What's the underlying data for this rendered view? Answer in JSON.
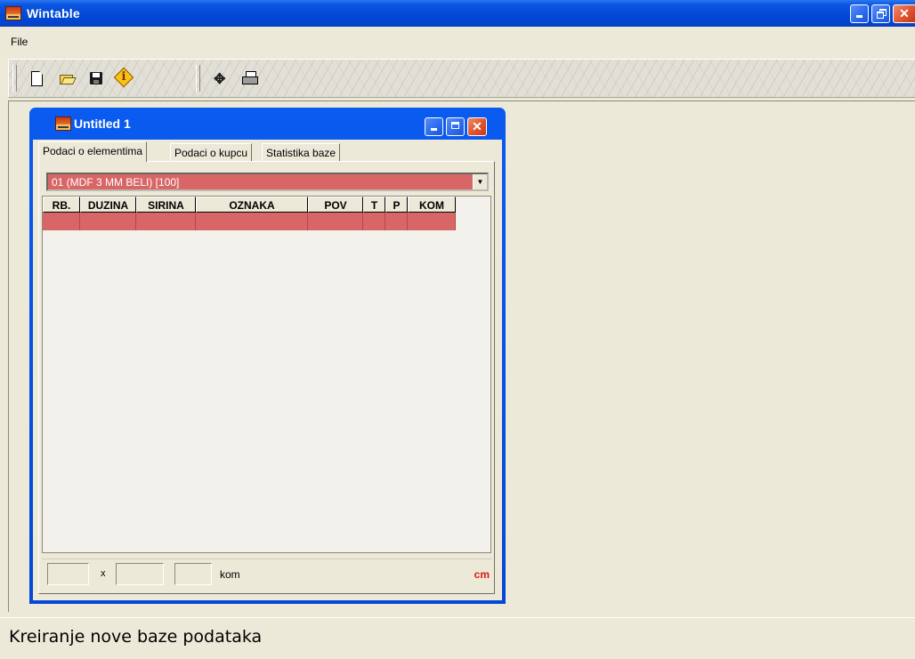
{
  "app": {
    "title": "Wintable",
    "icon": "app-logo-icon"
  },
  "menu": {
    "file_label": "File"
  },
  "toolbar": {
    "buttons": [
      "new-document-icon",
      "open-folder-icon",
      "save-disk-icon",
      "info-icon",
      "add-icon",
      "print-icon"
    ]
  },
  "child_window": {
    "title": "Untitled 1",
    "tabs": [
      {
        "label": "Podaci o elementima",
        "active": true
      },
      {
        "label": "Podaci o kupcu",
        "active": false
      },
      {
        "label": "Statistika baze",
        "active": false
      }
    ],
    "material_select": {
      "value": "01 (MDF 3 MM BELI) [100]"
    },
    "grid": {
      "columns": [
        "RB.",
        "DUZINA",
        "SIRINA",
        "OZNAKA",
        "POV",
        "T",
        "P",
        "KOM"
      ],
      "rows": [
        [
          "",
          "",
          "",
          "",
          "",
          "",
          "",
          ""
        ]
      ]
    },
    "inputs": {
      "length_value": "",
      "separator": "x",
      "width_value": "",
      "qty_value": "",
      "qty_unit": "kom",
      "unit": "cm"
    }
  },
  "colors": {
    "selection_row": "#d96666",
    "title_bar": "#0349d6",
    "unit_label": "#e01818"
  },
  "status": {
    "text": "Kreiranje nove baze podataka"
  }
}
